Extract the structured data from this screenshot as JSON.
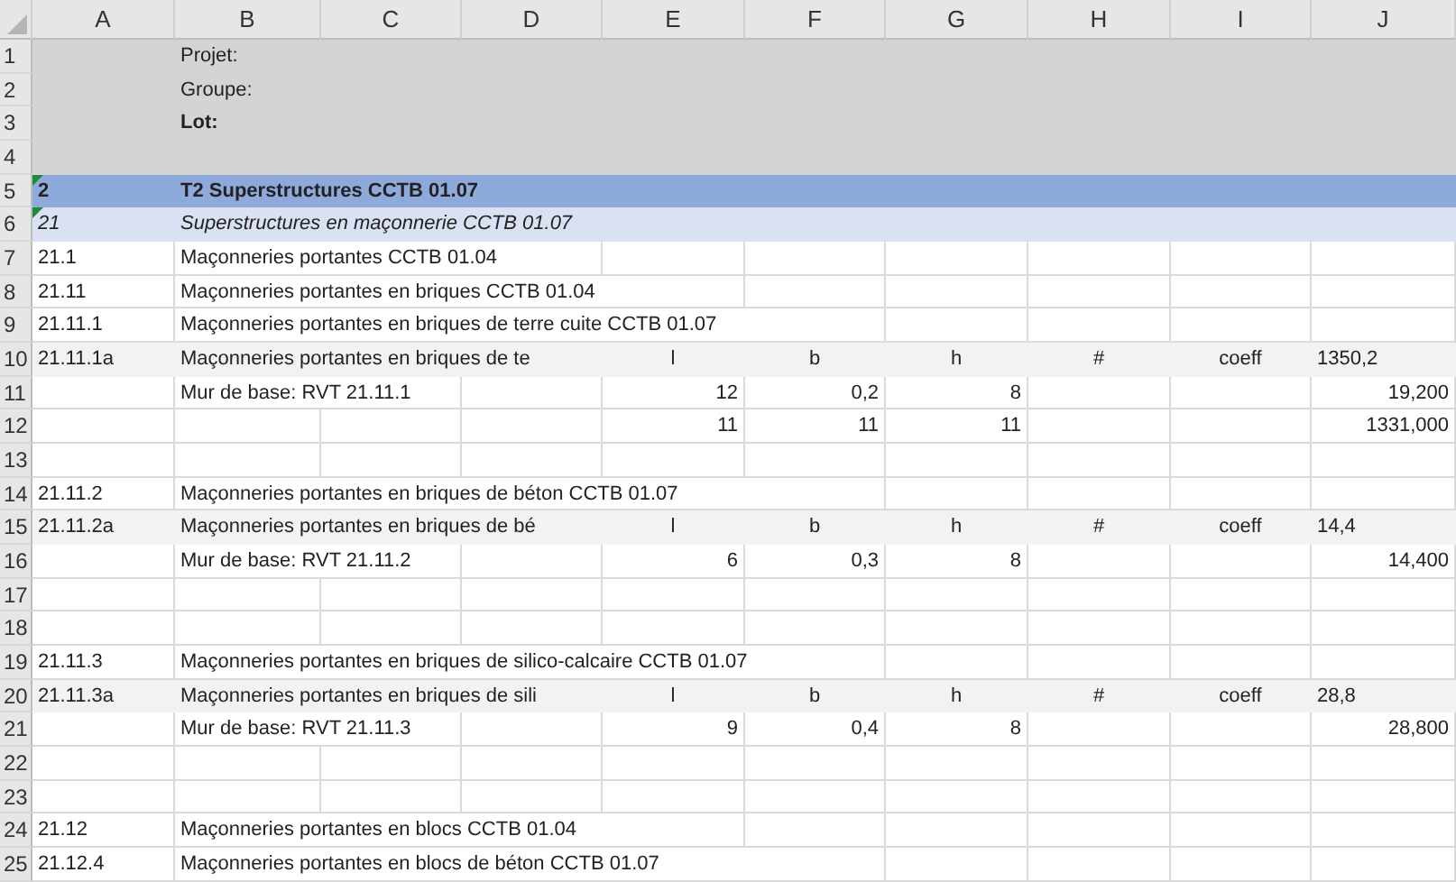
{
  "columns": [
    "A",
    "B",
    "C",
    "D",
    "E",
    "F",
    "G",
    "H",
    "I",
    "J"
  ],
  "rows": [
    {
      "number": "1",
      "kind": "info",
      "cells": {
        "B": {
          "text": "Projet:"
        }
      }
    },
    {
      "number": "2",
      "kind": "info",
      "cells": {
        "B": {
          "text": "Groupe:"
        }
      }
    },
    {
      "number": "3",
      "kind": "info",
      "cells": {
        "B": {
          "text": "Lot:",
          "bold": true
        }
      }
    },
    {
      "number": "4",
      "kind": "info",
      "cells": {}
    },
    {
      "number": "5",
      "kind": "section",
      "cells": {
        "A": {
          "text": "2",
          "flagged": true
        },
        "B": {
          "text": "T2 Superstructures CCTB 01.07"
        }
      }
    },
    {
      "number": "6",
      "kind": "subsection",
      "cells": {
        "A": {
          "text": "21",
          "flagged": true
        },
        "B": {
          "text": "Superstructures en maçonnerie CCTB 01.07"
        }
      }
    },
    {
      "number": "7",
      "kind": "normal",
      "cells": {
        "A": {
          "text": "21.1"
        },
        "B": {
          "text": "Maçonneries portantes CCTB 01.04"
        }
      }
    },
    {
      "number": "8",
      "kind": "normal",
      "cells": {
        "A": {
          "text": "21.11"
        },
        "B": {
          "text": "Maçonneries portantes en briques CCTB 01.04"
        }
      }
    },
    {
      "number": "9",
      "kind": "normal",
      "cells": {
        "A": {
          "text": "21.11.1"
        },
        "B": {
          "text": "Maçonneries portantes en briques de terre cuite CCTB 01.07"
        }
      }
    },
    {
      "number": "10",
      "kind": "measure",
      "cells": {
        "A": {
          "text": "21.11.1a"
        },
        "B": {
          "text": "Maçonneries portantes en briques de te"
        },
        "E": {
          "text": "l"
        },
        "F": {
          "text": "b"
        },
        "G": {
          "text": "h"
        },
        "H": {
          "text": "#"
        },
        "I": {
          "text": "coeff"
        },
        "J": {
          "text": "1350,2"
        }
      }
    },
    {
      "number": "11",
      "kind": "normal",
      "cells": {
        "B": {
          "text": "Mur de base: RVT 21.11.1"
        },
        "E": {
          "text": "12"
        },
        "F": {
          "text": "0,2"
        },
        "G": {
          "text": "8"
        },
        "J": {
          "text": "19,200"
        }
      }
    },
    {
      "number": "12",
      "kind": "normal",
      "cells": {
        "E": {
          "text": "11"
        },
        "F": {
          "text": "11"
        },
        "G": {
          "text": "11"
        },
        "J": {
          "text": "1331,000"
        }
      }
    },
    {
      "number": "13",
      "kind": "normal",
      "cells": {}
    },
    {
      "number": "14",
      "kind": "normal",
      "cells": {
        "A": {
          "text": "21.11.2"
        },
        "B": {
          "text": "Maçonneries portantes en briques de béton CCTB 01.07"
        }
      }
    },
    {
      "number": "15",
      "kind": "measure",
      "cells": {
        "A": {
          "text": "21.11.2a"
        },
        "B": {
          "text": "Maçonneries portantes en briques de bé"
        },
        "E": {
          "text": "l"
        },
        "F": {
          "text": "b"
        },
        "G": {
          "text": "h"
        },
        "H": {
          "text": "#"
        },
        "I": {
          "text": "coeff"
        },
        "J": {
          "text": "14,4"
        }
      }
    },
    {
      "number": "16",
      "kind": "normal",
      "cells": {
        "B": {
          "text": "Mur de base: RVT 21.11.2"
        },
        "E": {
          "text": "6"
        },
        "F": {
          "text": "0,3"
        },
        "G": {
          "text": "8"
        },
        "J": {
          "text": "14,400"
        }
      }
    },
    {
      "number": "17",
      "kind": "normal",
      "cells": {}
    },
    {
      "number": "18",
      "kind": "normal",
      "cells": {}
    },
    {
      "number": "19",
      "kind": "normal",
      "cells": {
        "A": {
          "text": "21.11.3"
        },
        "B": {
          "text": "Maçonneries portantes en briques de silico-calcaire CCTB 01.07"
        }
      }
    },
    {
      "number": "20",
      "kind": "measure",
      "cells": {
        "A": {
          "text": "21.11.3a"
        },
        "B": {
          "text": "Maçonneries portantes en briques de sili"
        },
        "E": {
          "text": "l"
        },
        "F": {
          "text": "b"
        },
        "G": {
          "text": "h"
        },
        "H": {
          "text": "#"
        },
        "I": {
          "text": "coeff"
        },
        "J": {
          "text": "28,8"
        }
      }
    },
    {
      "number": "21",
      "kind": "normal",
      "cells": {
        "B": {
          "text": "Mur de base: RVT 21.11.3"
        },
        "E": {
          "text": "9"
        },
        "F": {
          "text": "0,4"
        },
        "G": {
          "text": "8"
        },
        "J": {
          "text": "28,800"
        }
      }
    },
    {
      "number": "22",
      "kind": "normal",
      "cells": {}
    },
    {
      "number": "23",
      "kind": "normal",
      "cells": {}
    },
    {
      "number": "24",
      "kind": "normal",
      "cells": {
        "A": {
          "text": "21.12"
        },
        "B": {
          "text": "Maçonneries portantes en blocs CCTB 01.04"
        }
      }
    },
    {
      "number": "25",
      "kind": "normal",
      "cells": {
        "A": {
          "text": "21.12.4"
        },
        "B": {
          "text": "Maçonneries portantes en blocs de béton CCTB 01.07"
        }
      }
    }
  ]
}
